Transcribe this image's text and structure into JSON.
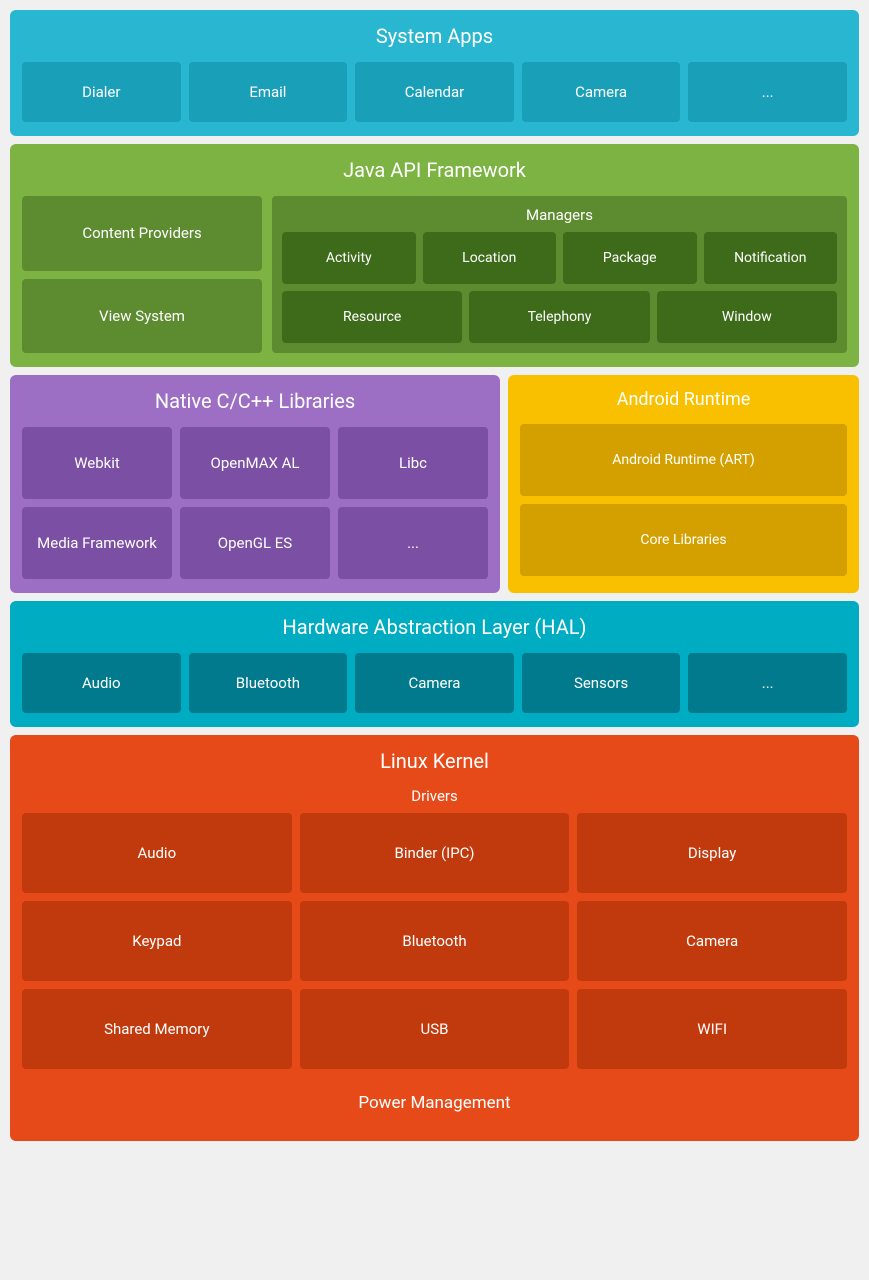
{
  "system_apps": {
    "title": "System Apps",
    "items": [
      "Dialer",
      "Email",
      "Calendar",
      "Camera",
      "..."
    ]
  },
  "java_api": {
    "title": "Java API Framework",
    "left": [
      "Content Providers",
      "View System"
    ],
    "managers_title": "Managers",
    "managers_row1": [
      "Activity",
      "Location",
      "Package",
      "Notification"
    ],
    "managers_row2": [
      "Resource",
      "Telephony",
      "Window"
    ]
  },
  "native_libs": {
    "title": "Native C/C++ Libraries",
    "items": [
      "Webkit",
      "OpenMAX AL",
      "Libc",
      "Media Framework",
      "OpenGL ES",
      "..."
    ]
  },
  "android_runtime": {
    "title": "Android Runtime",
    "items": [
      "Android Runtime (ART)",
      "Core Libraries"
    ]
  },
  "hal": {
    "title": "Hardware Abstraction Layer (HAL)",
    "items": [
      "Audio",
      "Bluetooth",
      "Camera",
      "Sensors",
      "..."
    ]
  },
  "linux_kernel": {
    "title": "Linux Kernel",
    "drivers_label": "Drivers",
    "drivers": [
      "Audio",
      "Binder (IPC)",
      "Display",
      "Keypad",
      "Bluetooth",
      "Camera",
      "Shared Memory",
      "USB",
      "WIFI"
    ],
    "power_management": "Power Management"
  }
}
